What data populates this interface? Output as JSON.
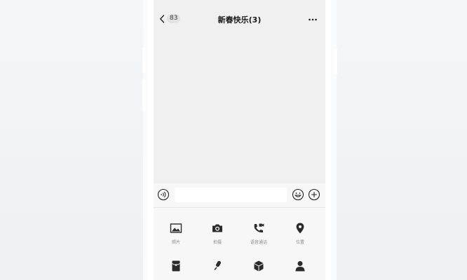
{
  "header": {
    "back_badge": "83",
    "title": "新春快乐(3)"
  },
  "panel": {
    "row1": [
      {
        "label": "照片",
        "icon": "image-icon"
      },
      {
        "label": "拍摄",
        "icon": "camera-icon"
      },
      {
        "label": "语音通话",
        "icon": "phone-video-icon"
      },
      {
        "label": "位置",
        "icon": "location-pin-icon"
      }
    ],
    "row2": [
      {
        "label": "",
        "icon": "red-packet-icon"
      },
      {
        "label": "",
        "icon": "microphone-icon"
      },
      {
        "label": "",
        "icon": "box-icon"
      },
      {
        "label": "",
        "icon": "person-icon"
      }
    ]
  },
  "colors": {
    "screen_bg": "#f1f0f0",
    "icon": "#2b2b2b",
    "label": "#8a8a8a"
  }
}
